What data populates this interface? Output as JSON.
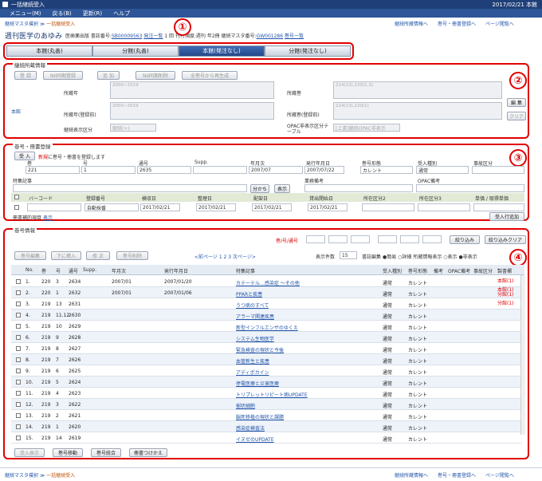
{
  "window": {
    "title": "一括継続受入",
    "date": "2017/02/21 本館"
  },
  "menu": [
    "メニュー(M)",
    "戻る(B)",
    "更新(R)",
    "ヘルプ"
  ],
  "breadcrumb": {
    "parent": "継続マスタ撲択",
    "sep": "≫",
    "current": "一括継続受入"
  },
  "toplinks": [
    "継続所蔵情報へ",
    "巻号・冊書登録へ",
    "ページ閲覧へ"
  ],
  "book": {
    "title": "週刊医学のあゆみ",
    "meta_pre": "医歯薬出版 書誌番号:",
    "bib_no": "SB00009563",
    "bib_link": "発注一覧",
    "meta_mid": "1 回 刊行頻度:週刊 年2冊 継続マスタ番号:",
    "master_no": "GW001286",
    "master_link": "巻号一覧"
  },
  "tabs": [
    {
      "label": "本館(丸善)",
      "active": false
    },
    {
      "label": "分館(丸善)",
      "active": false
    },
    {
      "label": "本館(発注なし)",
      "active": true
    },
    {
      "label": "分館(発注なし)",
      "active": false
    }
  ],
  "callouts": [
    "①",
    "②",
    "③",
    "④"
  ],
  "holdings": {
    "section": "継続所蔵情報",
    "buttons": [
      "登 録",
      "NII同期登録",
      "追 加",
      "NII同期削除",
      "全巻号から再生成"
    ],
    "side_label": "本館",
    "f_year": "所蔵年",
    "f_year_val": "2000~2019",
    "f_vol": "所蔵巻",
    "f_vol_val": "214(13),220(1,3)",
    "f_year2": "所蔵年(登録前)",
    "f_year2_val": "2000~2019",
    "f_vol2": "所蔵巻(登録前)",
    "f_vol2_val": "214(13),220(1)",
    "f_disp": "継続表示区分",
    "f_disp_val": "継続(+)",
    "f_opac": "OPAC非表示区分テーブル",
    "f_opac_val": "[上書]継続OPAC非表示",
    "edit": "編 集",
    "clear": "クリア"
  },
  "register": {
    "section": "巻号・冊書登録",
    "accept": "受 入",
    "hint_red": "新規",
    "hint": "に巻号・冊書を登録します",
    "cols": [
      "巻",
      "号",
      "通号",
      "Supp.",
      "年月次",
      "発行年月日",
      "巻号形態",
      "受入種別",
      "事故区分"
    ],
    "vals": [
      "221",
      "1",
      "2635",
      "",
      "2007/07",
      "2007/07/22",
      "カレント",
      "通常",
      ""
    ],
    "special": "特集記事",
    "split": "分かち",
    "show": "表示",
    "business": "業務備考",
    "opac": "OPAC備考",
    "cols2": [
      "バーコード",
      "登録番号",
      "検収日",
      "整理日",
      "配架日",
      "貸出開始日",
      "所在区分2",
      "所在区分3",
      "単価 / 取得単価"
    ],
    "vals2": [
      "",
      "自動採番",
      "2017/02/21",
      "2017/02/21",
      "2017/02/21",
      "2017/02/21",
      "",
      "",
      ""
    ],
    "count": "冊書補的項目",
    "count_link": "表示",
    "add_row": "受入行追加"
  },
  "list": {
    "section": "巻号情報",
    "vol_no": "巻/号/通号",
    "filter": "絞り込み",
    "filter_clear": "絞り込みクリア",
    "buttons": [
      "巻号編集",
      "下に挿入",
      "修 正",
      "巻号削除"
    ],
    "pager": "<前ページ 1 2 3 次ページ>",
    "per_page_label": "表示件数",
    "per_page": "15",
    "order_label": "書誌編集",
    "opt1": "簡易",
    "opt2": "詳細",
    "disp_label": "所蔵情報表示",
    "opt3": "表示",
    "opt4": "非表示",
    "headers": [
      "No.",
      "巻",
      "号",
      "通号",
      "Supp.",
      "年月次",
      "発行年月日",
      "特集記事",
      "受入種別",
      "巻号形態",
      "備考",
      "OPAC備考",
      "事故区分",
      "製書欄"
    ],
    "rows": [
      {
        "no": "1.",
        "vol": "220",
        "iss": "3",
        "tsu": "2634",
        "ym": "2007/01",
        "date": "2007/01/20",
        "art": "カテーテル…感染症 ～その他",
        "kind": "通常",
        "form": "カレント",
        "st": "本館(1)"
      },
      {
        "no": "2.",
        "vol": "220",
        "iss": "1",
        "tsu": "2632",
        "ym": "2007/01",
        "date": "2007/01/06",
        "art": "PPARと疾患",
        "kind": "通常",
        "form": "カレント",
        "st": "本館(1)\n分館(1)"
      },
      {
        "no": "3.",
        "vol": "219",
        "iss": "13",
        "tsu": "2631",
        "ym": "",
        "date": "",
        "art": "うつ病のすべて",
        "kind": "通常",
        "form": "カレント",
        "st": "分館(1)"
      },
      {
        "no": "4.",
        "vol": "219",
        "iss": "11.12",
        "tsu": "2630",
        "ym": "",
        "date": "",
        "art": "アラーマ関連疾患",
        "kind": "通常",
        "form": "カレント",
        "st": ""
      },
      {
        "no": "5.",
        "vol": "219",
        "iss": "10",
        "tsu": "2629",
        "ym": "",
        "date": "",
        "art": "新型インフルエンザのゆくえ",
        "kind": "通常",
        "form": "カレント",
        "st": ""
      },
      {
        "no": "6.",
        "vol": "219",
        "iss": "9",
        "tsu": "2628",
        "ym": "",
        "date": "",
        "art": "システム生物医学",
        "kind": "通常",
        "form": "カレント",
        "st": ""
      },
      {
        "no": "7.",
        "vol": "219",
        "iss": "8",
        "tsu": "2627",
        "ym": "",
        "date": "",
        "art": "緊急検査の現状と今後",
        "kind": "通常",
        "form": "カレント",
        "st": ""
      },
      {
        "no": "8.",
        "vol": "219",
        "iss": "7",
        "tsu": "2626",
        "ym": "",
        "date": "",
        "art": "血管新生と疾患",
        "kind": "通常",
        "form": "カレント",
        "st": ""
      },
      {
        "no": "9.",
        "vol": "219",
        "iss": "6",
        "tsu": "2625",
        "ym": "",
        "date": "",
        "art": "アディポカイン",
        "kind": "通常",
        "form": "カレント",
        "st": ""
      },
      {
        "no": "10.",
        "vol": "219",
        "iss": "5",
        "tsu": "2624",
        "ym": "",
        "date": "",
        "art": "停電医療と災害医療",
        "kind": "通常",
        "form": "カレント",
        "st": ""
      },
      {
        "no": "11.",
        "vol": "219",
        "iss": "4",
        "tsu": "2623",
        "ym": "",
        "date": "",
        "art": "トリプレットリピート病UPDATE",
        "kind": "通常",
        "form": "カレント",
        "st": ""
      },
      {
        "no": "12.",
        "vol": "219",
        "iss": "3",
        "tsu": "2622",
        "ym": "",
        "date": "",
        "art": "樹状細胞",
        "kind": "通常",
        "form": "カレント",
        "st": ""
      },
      {
        "no": "13.",
        "vol": "219",
        "iss": "2",
        "tsu": "2621",
        "ym": "",
        "date": "",
        "art": "脳死移植の現状と課題",
        "kind": "通常",
        "form": "カレント",
        "st": ""
      },
      {
        "no": "14.",
        "vol": "219",
        "iss": "1",
        "tsu": "2620",
        "ym": "",
        "date": "",
        "art": "感染症検査法",
        "kind": "通常",
        "form": "カレント",
        "st": ""
      },
      {
        "no": "15.",
        "vol": "219",
        "iss": "14",
        "tsu": "2619",
        "ym": "",
        "date": "",
        "art": "イヌゼのUPDATE",
        "kind": "通常",
        "form": "カレント",
        "st": ""
      }
    ],
    "bottom": [
      "受入表示",
      "巻号移動",
      "巻号統合",
      "冊書つけかえ"
    ]
  },
  "footer": {
    "crumb": "継続マスタ撲択",
    "current": "一括継続受入",
    "links": [
      "継続所蔵情報へ",
      "巻号・冊書登録へ",
      "ページ閲覧へ"
    ]
  }
}
